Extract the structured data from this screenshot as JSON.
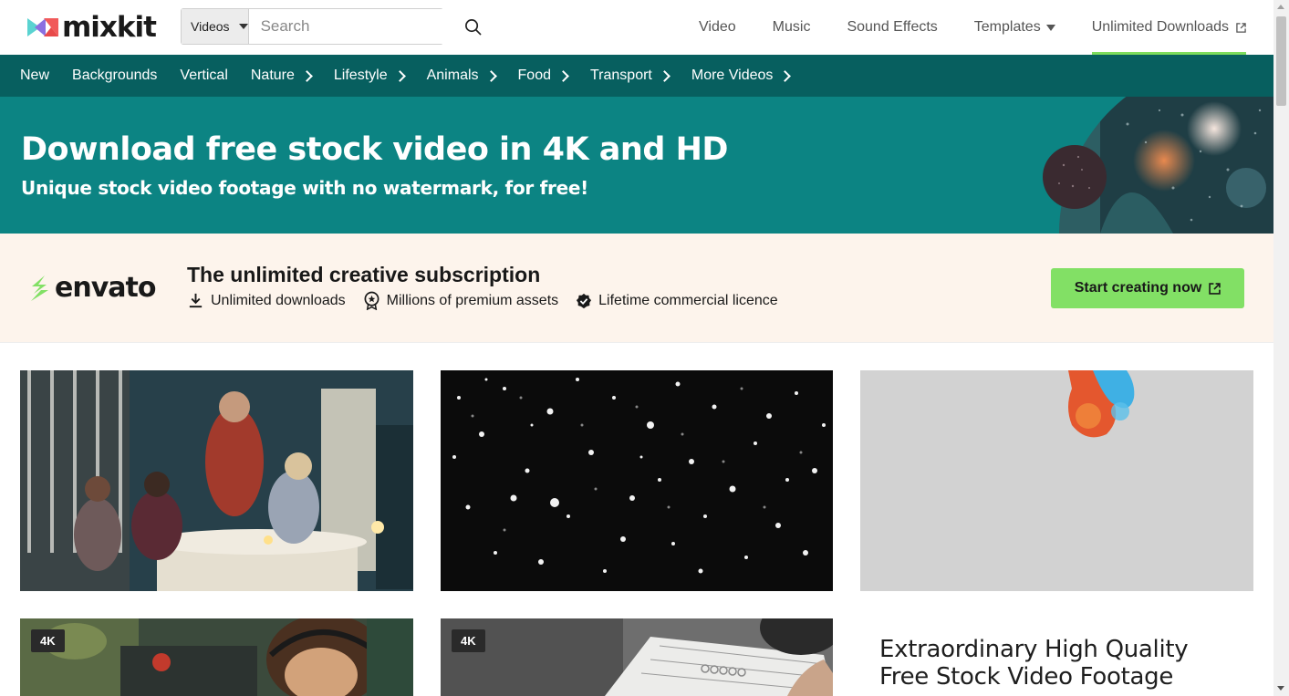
{
  "header": {
    "logo_text": "mixkit",
    "search": {
      "category": "Videos",
      "placeholder": "Search",
      "value": ""
    },
    "nav": [
      {
        "label": "Video"
      },
      {
        "label": "Music"
      },
      {
        "label": "Sound Effects"
      },
      {
        "label": "Templates"
      },
      {
        "label": "Unlimited Downloads"
      }
    ]
  },
  "categories": [
    {
      "label": "New"
    },
    {
      "label": "Backgrounds"
    },
    {
      "label": "Vertical"
    },
    {
      "label": "Nature"
    },
    {
      "label": "Lifestyle"
    },
    {
      "label": "Animals"
    },
    {
      "label": "Food"
    },
    {
      "label": "Transport"
    },
    {
      "label": "More Videos"
    }
  ],
  "hero": {
    "title": "Download free stock video in 4K and HD",
    "subtitle": "Unique stock video footage with no watermark, for free!"
  },
  "promo": {
    "brand": "envato",
    "title": "The unlimited creative subscription",
    "features": [
      {
        "label": "Unlimited downloads",
        "icon": "download-icon"
      },
      {
        "label": "Millions of premium assets",
        "icon": "award-badge-icon"
      },
      {
        "label": "Lifetime commercial licence",
        "icon": "check-badge-icon"
      }
    ],
    "cta_label": "Start creating now"
  },
  "videos": [
    {
      "name": "family-dinner",
      "badge": ""
    },
    {
      "name": "falling-particles",
      "badge": ""
    },
    {
      "name": "colored-ink",
      "badge": ""
    },
    {
      "name": "woman-headphones",
      "badge": "4K"
    },
    {
      "name": "writing-notebook",
      "badge": "4K"
    }
  ],
  "side_heading": "Extraordinary High Quality Free Stock Video Footage",
  "colors": {
    "category_bar": "#075f5f",
    "hero": "#0c8483",
    "promo_bg": "#fdf4ec",
    "cta": "#82e065",
    "active_underline": "#7ddc5c"
  }
}
